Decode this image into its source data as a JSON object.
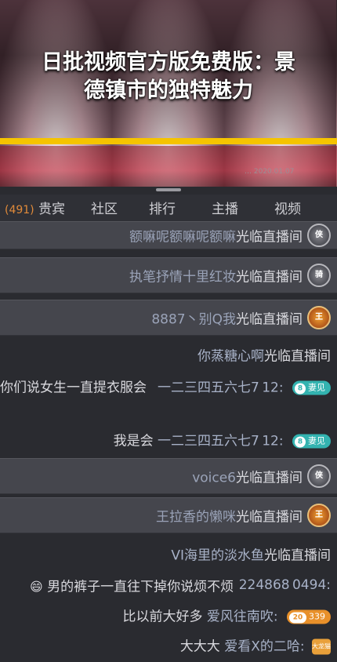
{
  "video": {
    "title_line1": "日批视频官方版免费版：景",
    "title_line2": "德镇市的独特魅力",
    "watermark": "… 2020.01.07"
  },
  "tabs": {
    "guest_label": "贵宾",
    "guest_count": "(491)",
    "community": "社区",
    "ranking": "排行",
    "anchor": "主播",
    "video": "视频"
  },
  "chat": [
    {
      "name": "额嘛呢额嘛呢额嘛",
      "text": "光临直播间",
      "badge": "侠"
    },
    {
      "name": "执笔抒情十里红妆",
      "text": "光临直播间",
      "badge": "骑"
    },
    {
      "name": "8887丶别Q我",
      "text": "光临直播间",
      "badge": "王"
    },
    {
      "name": "你蒸糖心啊",
      "text": "光临直播间"
    },
    {
      "name": "一二三四五六七7 12:",
      "text": " 你们说女生一直提衣服会",
      "level": "8",
      "pill": "妻见"
    },
    {
      "name": "一二三四五六七7 12:",
      "text": " 我是会",
      "level": "8",
      "pill": "妻见"
    },
    {
      "name": "voice6",
      "text": "光临直播间",
      "badge": "侠"
    },
    {
      "name": "王拉香的懒咪",
      "text": "光临直播间",
      "badge": "王"
    },
    {
      "name": "VI海里的淡水鱼",
      "text": "光临直播间"
    },
    {
      "name": "224868 0494:",
      "text": " 男的裤子一直往下掉你说烦不烦",
      "emoji": "😄"
    },
    {
      "name": "爱风往南吹:",
      "text": " 比以前大好多",
      "level": "20",
      "pill": "339"
    },
    {
      "name": "爱看X的二哈:",
      "text": " 大大大",
      "badge2": "大龙猫"
    }
  ]
}
